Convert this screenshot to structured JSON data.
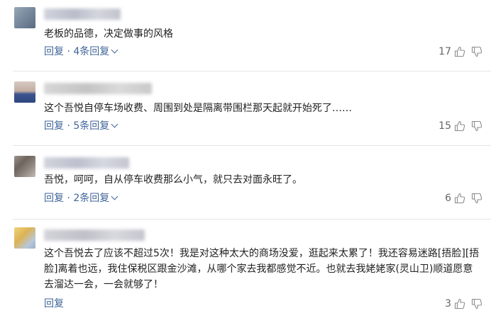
{
  "comments": [
    {
      "text": "老板的品德，决定做事的风格",
      "reply_label": "回复",
      "separator": " · ",
      "replies_label": "4条回复",
      "likes": "17",
      "avatar_colors": [
        "#9aa7b6",
        "#5a6b80"
      ],
      "name_color": "#c9cbd6"
    },
    {
      "text": "这个吾悦自停车场收费、周围到处是隔离带围栏那天起就开始死了……",
      "reply_label": "回复",
      "separator": " · ",
      "replies_label": "5条回复",
      "likes": "15",
      "avatar_colors": [
        "#c8b6ad",
        "#344e8c"
      ],
      "name_color": "#cfcfcf"
    },
    {
      "text": "吾悦，呵呵，自从停车收费那么小气，就只去对面永旺了。",
      "reply_label": "回复",
      "separator": " · ",
      "replies_label": "2条回复",
      "likes": "6",
      "avatar_colors": [
        "#7a7068",
        "#b0a8a0"
      ],
      "name_color": "#c9ccd8"
    },
    {
      "text": "这个吾悦去了应该不超过5次！我是对这种太大的商场没爱，逛起来太累了！我还容易迷路[捂脸][捂脸]离着也远，我住保税区跟金沙滩，从哪个家去我都感觉不近。也就去我姥姥家(灵山卫)顺道愿意去溜达一会，一会就够了！",
      "reply_label": "回复",
      "likes": "3",
      "avatar_colors": [
        "#e8c46a",
        "#a8c0d8"
      ],
      "name_color": "#ccccd4"
    }
  ]
}
